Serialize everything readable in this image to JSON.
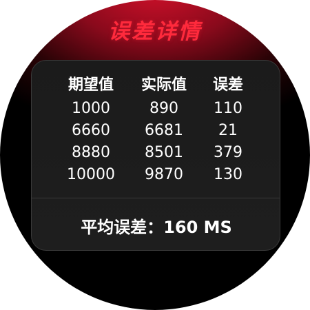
{
  "title": "误差详情",
  "table": {
    "headers": [
      "期望值",
      "实际值",
      "误差"
    ],
    "rows": [
      [
        "1000",
        "890",
        "110"
      ],
      [
        "6660",
        "6681",
        "21"
      ],
      [
        "8880",
        "8501",
        "379"
      ],
      [
        "10000",
        "9870",
        "130"
      ]
    ]
  },
  "summary": {
    "label": "平均误差：",
    "value": "160 MS"
  },
  "colors": {
    "accent": "#ff2a3c",
    "background": "#000000",
    "card": "#1c1c1c"
  }
}
